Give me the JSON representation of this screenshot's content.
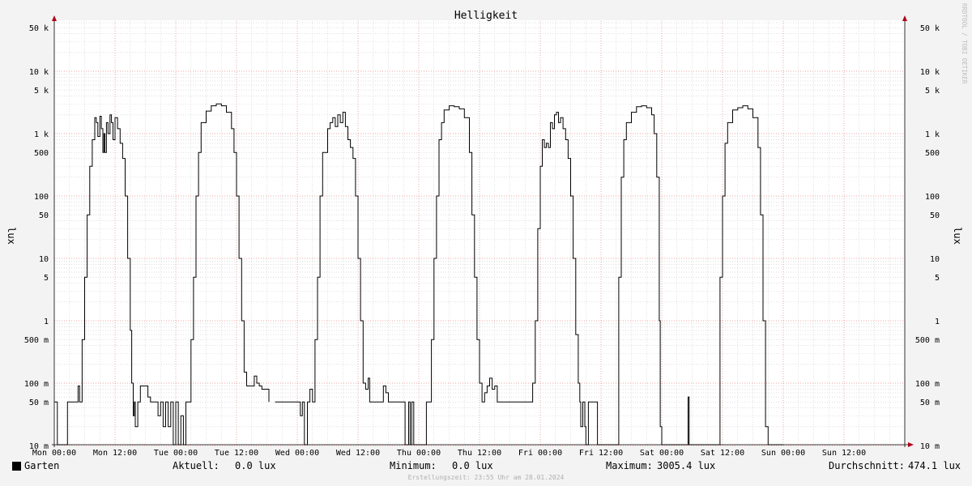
{
  "chart_data": {
    "type": "line",
    "title": "Helligkeit",
    "ylabel": "lux",
    "ylabel_right": "lux",
    "yscale": "log",
    "ylim": [
      10,
      60000
    ],
    "xlim": [
      "Mon 00:00",
      "Mon 00:00 (+7 days)"
    ],
    "x_tick_labels": [
      "Mon 00:00",
      "Mon 12:00",
      "Tue 00:00",
      "Tue 12:00",
      "Wed 00:00",
      "Wed 12:00",
      "Thu 00:00",
      "Thu 12:00",
      "Fri 00:00",
      "Fri 12:00",
      "Sat 00:00",
      "Sat 12:00",
      "Sun 00:00",
      "Sun 12:00"
    ],
    "y_tick_values": [
      10,
      50,
      100,
      500,
      1000,
      5000,
      10000,
      50000
    ],
    "y_tick_labels": [
      "10 m",
      "50 m",
      "100 m",
      "500 m",
      "1",
      "5",
      "10",
      "50",
      "100",
      "500",
      "1 k",
      "5 k",
      "10 k",
      "50 k"
    ],
    "y_tick_labels_note_unused": "",
    "grid": true,
    "legend_position": "bottom",
    "series": [
      {
        "name": "Garten",
        "color": "#000000",
        "x_unit": "hours since Mon 00:00",
        "points": [
          [
            0,
            0.05
          ],
          [
            0.5,
            0.05
          ],
          [
            0.6,
            0.01
          ],
          [
            2.5,
            0.01
          ],
          [
            2.6,
            0.05
          ],
          [
            4.5,
            0.05
          ],
          [
            4.7,
            0.09
          ],
          [
            5,
            0.05
          ],
          [
            5.5,
            0.5
          ],
          [
            6,
            5
          ],
          [
            6.5,
            50
          ],
          [
            7,
            300
          ],
          [
            7.5,
            800
          ],
          [
            8,
            1800
          ],
          [
            8.3,
            1500
          ],
          [
            8.6,
            900
          ],
          [
            9,
            1900
          ],
          [
            9.3,
            1200
          ],
          [
            9.6,
            500
          ],
          [
            9.8,
            1000
          ],
          [
            10,
            500
          ],
          [
            10.3,
            1500
          ],
          [
            10.6,
            1000
          ],
          [
            11,
            2000
          ],
          [
            11.3,
            1500
          ],
          [
            11.6,
            800
          ],
          [
            12,
            1800
          ],
          [
            12.5,
            1200
          ],
          [
            13,
            700
          ],
          [
            13.5,
            400
          ],
          [
            14,
            100
          ],
          [
            14.5,
            10
          ],
          [
            15,
            0.7
          ],
          [
            15.3,
            0.1
          ],
          [
            15.6,
            0.03
          ],
          [
            15.8,
            0.05
          ],
          [
            16,
            0.02
          ],
          [
            16.5,
            0.05
          ],
          [
            17,
            0.09
          ],
          [
            18,
            0.09
          ],
          [
            18.5,
            0.06
          ],
          [
            19,
            0.05
          ],
          [
            20,
            0.05
          ],
          [
            20.5,
            0.03
          ],
          [
            21,
            0.05
          ],
          [
            21.5,
            0.02
          ],
          [
            22,
            0.05
          ],
          [
            22.5,
            0.02
          ],
          [
            23,
            0.05
          ],
          [
            23.5,
            0.01
          ],
          [
            24,
            0.05
          ],
          [
            24.5,
            0.01
          ],
          [
            25,
            0.03
          ],
          [
            25.5,
            0.01
          ],
          [
            26,
            0.05
          ],
          [
            26.5,
            0.05
          ],
          [
            27,
            0.5
          ],
          [
            27.5,
            5
          ],
          [
            28,
            100
          ],
          [
            28.5,
            500
          ],
          [
            29,
            1500
          ],
          [
            30,
            2300
          ],
          [
            31,
            2800
          ],
          [
            32,
            3000
          ],
          [
            33,
            2800
          ],
          [
            34,
            2200
          ],
          [
            35,
            1200
          ],
          [
            35.5,
            500
          ],
          [
            36,
            100
          ],
          [
            36.5,
            10
          ],
          [
            37,
            1
          ],
          [
            37.5,
            0.15
          ],
          [
            38,
            0.09
          ],
          [
            39,
            0.09
          ],
          [
            39.5,
            0.13
          ],
          [
            40,
            0.1
          ],
          [
            40.5,
            0.09
          ],
          [
            41,
            0.08
          ],
          [
            42,
            0.08
          ],
          [
            42.4,
            0.05
          ]
        ],
        "points_b": [
          [
            43.6,
            0.05
          ],
          [
            48,
            0.05
          ],
          [
            48.6,
            0.03
          ],
          [
            49,
            0.05
          ],
          [
            49.4,
            0.01
          ],
          [
            50,
            0.05
          ],
          [
            50.5,
            0.08
          ],
          [
            51,
            0.05
          ],
          [
            51.5,
            0.5
          ],
          [
            52,
            5
          ],
          [
            52.5,
            100
          ],
          [
            53,
            500
          ],
          [
            54,
            1200
          ],
          [
            54.5,
            1500
          ],
          [
            55,
            1800
          ],
          [
            55.5,
            1300
          ],
          [
            56,
            2000
          ],
          [
            56.5,
            1500
          ],
          [
            57,
            2200
          ],
          [
            57.5,
            1300
          ],
          [
            58,
            800
          ],
          [
            58.5,
            600
          ],
          [
            59,
            400
          ],
          [
            59.5,
            100
          ],
          [
            60,
            10
          ],
          [
            60.5,
            1
          ],
          [
            61,
            0.1
          ],
          [
            61.5,
            0.08
          ],
          [
            62,
            0.12
          ],
          [
            62.3,
            0.05
          ],
          [
            63,
            0.05
          ],
          [
            64,
            0.05
          ],
          [
            65,
            0.09
          ],
          [
            65.5,
            0.07
          ],
          [
            66,
            0.05
          ],
          [
            67,
            0.05
          ],
          [
            68,
            0.05
          ],
          [
            69,
            0.05
          ],
          [
            69.3,
            0.01
          ],
          [
            70,
            0.05
          ],
          [
            70.3,
            0.01
          ],
          [
            70.6,
            0.05
          ],
          [
            71,
            0.01
          ],
          [
            72,
            0.01
          ],
          [
            73,
            0.01
          ],
          [
            73.5,
            0.05
          ],
          [
            74,
            0.05
          ],
          [
            74.5,
            0.5
          ],
          [
            75,
            10
          ],
          [
            75.5,
            100
          ],
          [
            76,
            800
          ],
          [
            76.5,
            1500
          ],
          [
            77,
            2400
          ],
          [
            78,
            2800
          ],
          [
            79,
            2700
          ],
          [
            80,
            2500
          ],
          [
            81,
            1800
          ],
          [
            82,
            500
          ],
          [
            82.5,
            50
          ],
          [
            83,
            5
          ],
          [
            83.5,
            0.5
          ],
          [
            84,
            0.1
          ],
          [
            84.5,
            0.05
          ],
          [
            85,
            0.07
          ],
          [
            85.5,
            0.09
          ],
          [
            86,
            0.12
          ],
          [
            86.5,
            0.08
          ],
          [
            87,
            0.09
          ],
          [
            87.5,
            0.05
          ],
          [
            88,
            0.05
          ],
          [
            90,
            0.05
          ],
          [
            92,
            0.05
          ],
          [
            94,
            0.05
          ],
          [
            94.5,
            0.1
          ],
          [
            95,
            1
          ],
          [
            95.5,
            30
          ],
          [
            96,
            300
          ],
          [
            96.4,
            800
          ],
          [
            96.8,
            600
          ],
          [
            97.2,
            700
          ],
          [
            97.6,
            600
          ],
          [
            98,
            1500
          ],
          [
            98.4,
            1200
          ],
          [
            98.8,
            2000
          ],
          [
            99.2,
            2200
          ],
          [
            99.6,
            1500
          ],
          [
            100,
            1800
          ],
          [
            100.5,
            1200
          ],
          [
            101,
            800
          ],
          [
            101.5,
            400
          ],
          [
            102,
            100
          ],
          [
            102.5,
            10
          ],
          [
            103,
            0.6
          ],
          [
            103.5,
            0.1
          ],
          [
            103.8,
            0.05
          ],
          [
            104,
            0.02
          ],
          [
            104.4,
            0.05
          ],
          [
            104.8,
            0.02
          ],
          [
            105,
            0.01
          ],
          [
            105.5,
            0.05
          ],
          [
            106,
            0.05
          ],
          [
            106.5,
            0.05
          ],
          [
            107,
            0.05
          ],
          [
            107.3,
            0.01
          ],
          [
            108,
            0.01
          ],
          [
            110,
            0.01
          ],
          [
            111,
            0.01
          ],
          [
            111.5,
            5
          ],
          [
            112,
            200
          ],
          [
            112.5,
            800
          ],
          [
            113,
            1500
          ],
          [
            114,
            2200
          ],
          [
            115,
            2700
          ],
          [
            116,
            2800
          ],
          [
            117,
            2600
          ],
          [
            118,
            2000
          ],
          [
            118.5,
            1000
          ],
          [
            119,
            200
          ],
          [
            119.5,
            1
          ],
          [
            119.7,
            0.02
          ],
          [
            120,
            0.01
          ],
          [
            125,
            0.01
          ],
          [
            125.2,
            0.06
          ],
          [
            125.4,
            0.01
          ],
          [
            130,
            0.01
          ],
          [
            131,
            0.01
          ],
          [
            131.5,
            5
          ],
          [
            132,
            100
          ],
          [
            132.5,
            700
          ],
          [
            133,
            1500
          ],
          [
            134,
            2400
          ],
          [
            135,
            2600
          ],
          [
            136,
            2800
          ],
          [
            137,
            2500
          ],
          [
            138,
            1800
          ],
          [
            139,
            600
          ],
          [
            139.5,
            50
          ],
          [
            140,
            1
          ],
          [
            140.5,
            0.02
          ],
          [
            141,
            0.01
          ],
          [
            144,
            0.01
          ]
        ]
      }
    ]
  },
  "legend": {
    "series_name": "Garten",
    "current_label": "Aktuell:",
    "current_value": "0.0 lux",
    "min_label": "Minimum:",
    "min_value": "0.0 lux",
    "max_label": "Maximum:",
    "max_value": "3005.4 lux",
    "avg_label": "Durchschnitt:",
    "avg_value": "474.1 lux"
  },
  "footer": "Erstellungszeit: 23:55 Uhr am 28.01.2024",
  "watermark": "RRDTOOL / TOBI OETIKER"
}
